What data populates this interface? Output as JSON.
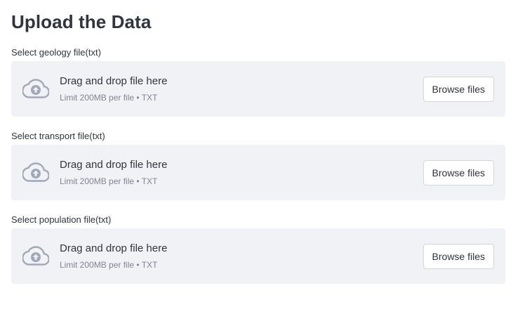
{
  "page": {
    "title": "Upload the Data"
  },
  "uploaders": [
    {
      "label": "Select geology file(txt)",
      "instructions": "Drag and drop file here",
      "limit": "Limit 200MB per file • TXT",
      "button": "Browse files",
      "icon": "cloud-upload-icon"
    },
    {
      "label": "Select transport file(txt)",
      "instructions": "Drag and drop file here",
      "limit": "Limit 200MB per file • TXT",
      "button": "Browse files",
      "icon": "cloud-upload-icon"
    },
    {
      "label": "Select population file(txt)",
      "instructions": "Drag and drop file here",
      "limit": "Limit 200MB per file • TXT",
      "button": "Browse files",
      "icon": "cloud-upload-icon"
    }
  ],
  "colors": {
    "text": "#31333f",
    "muted": "#808495",
    "dropzone_bg": "#f0f2f6",
    "icon": "#a3a8b8",
    "button_border": "#d6d6d9"
  }
}
